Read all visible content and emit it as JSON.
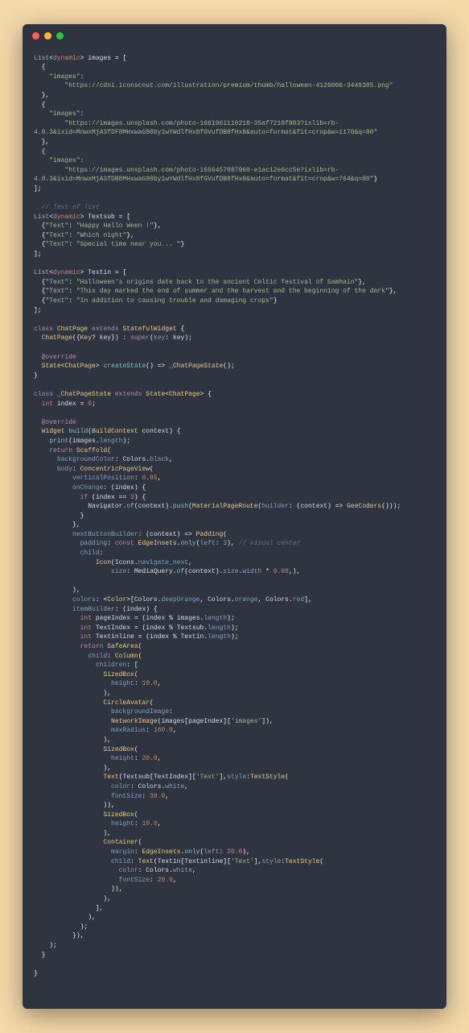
{
  "code": {
    "images_decl": "List<dynamic> images = [",
    "img_key": "\"images\"",
    "url1": "\"https://cdni.iconscout.com/illustration/premium/thumb/halloween-4126006-3449385.png\"",
    "url2a": "\"https://images.unsplash.com/photo-1661961110218-35af7210f803?ixlib=rb-",
    "url2b": "4.0.3&ixid=MnwxMjA3fDF8MHxwaG90by1wYWdlfHx8fGVufDB8fHx8&auto=format&fit=crop&w=1170&q=80\"",
    "url3a": "\"https://images.unsplash.com/photo-1666457087960-e1ac12e6cc5e?ixlib=rb-",
    "url3b": "4.0.3&ixid=MnwxMjA3fDB8MHxwaG90by1wYWdlfHx8fGVufDB8fHx8&auto=format&fit=crop&w=764&q=80\"",
    "comment_textlist": "// Text of list",
    "textsub_decl": "List<dynamic> Textsub = [",
    "t1": "\"Happy Hallo Ween !\"",
    "t2": "\"Which night\"",
    "t3": "\"Special time near you... \"",
    "textin_decl": "List<dynamic> Textin = [",
    "ti1": "\"Halloween's origins date back to the ancient Celtic festival of Samhain\"",
    "ti2": "\"This day marked the end of summer and the harvest and the beginning of the dark\"",
    "ti3": "\"In addition to causing trouble and damaging crops\"",
    "class_chatpage": "class ChatPage extends StatefulWidget {",
    "ctor": "  ChatPage({Key? key}) : super(key: key);",
    "override": "@override",
    "createstate": "  State<ChatPage> createState() => _ChatPageState();",
    "class_state": "class _ChatPageState extends State<ChatPage> {",
    "idx": "  int index = 0;",
    "build_sig": "  Widget build(BuildContext context) {",
    "print": "    print(images.length);",
    "return_scaffold": "    return Scaffold(",
    "bg": "      backgroundColor: Colors.black,",
    "body": "      body: ConcentricPageView(",
    "vpos": "          verticalPosition: 0.85,",
    "onchange": "          onChange: (index) {",
    "ifline": "            if (index == 3) {",
    "nav": "              Navigator.of(context).push(MaterialPageRoute(builder: (context) => GeeCoders()));",
    "nbb": "          nextButtonBuilder: (context) => Padding(",
    "padding": "            padding: const EdgeInsets.only(left: 3),",
    "visual": "// visual center",
    "child": "            child:",
    "icon": "                Icon(Icons.navigate_next,",
    "iconsize": "                    size: MediaQuery.of(context).size.width * 0.08,),",
    "colors": "          colors: <Color>[Colors.deepOrange, Colors.orange, Colors.red],",
    "itembuilder": "          itemBuilder: (index) {",
    "pgidx": "            int pageIndex = (index % images.length);",
    "tidx": "            int TextIndex = (index % Textsub.length);",
    "tinline": "            int Textinline = (index % Textin.length);",
    "retsafe": "            return SafeArea(",
    "childcol": "              child: Column(",
    "children": "                children: [",
    "sb10a": "                  SizedBox(",
    "h10": "                    height: 10.0,",
    "circle": "                  CircleAvatar(",
    "bgimg": "                    backgroundImage:",
    "netimg": "                    NetworkImage(images[pageIndex]['images']),",
    "maxr": "                    maxRadius: 180.0,",
    "sb20": "                  SizedBox(",
    "h20": "                    height: 20.0,",
    "text1": "                  Text(Textsub[TextIndex]['Text'],style:TextStyle(",
    "colw": "                    color: Colors.white,",
    "fs30": "                    fontSize: 30.0,",
    "container": "                  Container(",
    "margin": "                    margin: EdgeInsets.only(left: 20.0),",
    "childtxt": "                    child: Text(Textin[Textinline]['Text'],style:TextStyle(",
    "fs20": "                      fontSize: 20.0,",
    "textkey": "\"Text\""
  },
  "chart_data": null
}
